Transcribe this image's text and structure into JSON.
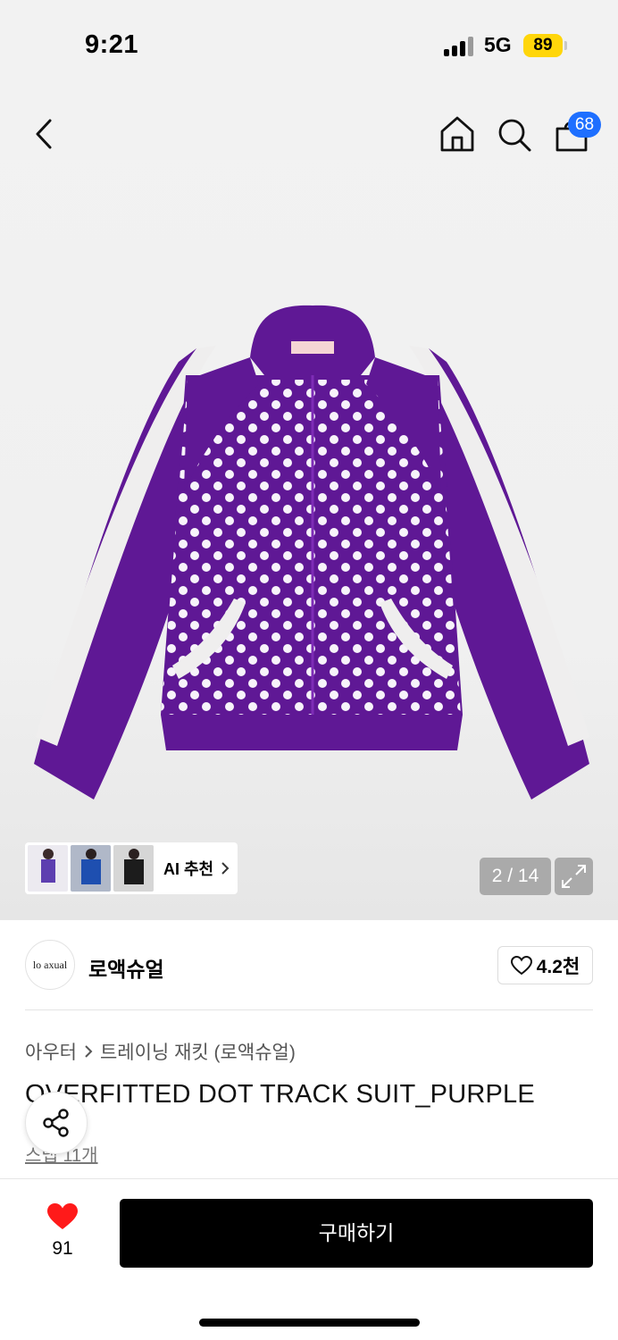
{
  "status_bar": {
    "time": "9:21",
    "network": "5G",
    "battery": "89"
  },
  "header": {
    "back_icon": "chevron-left-icon",
    "home_icon": "home-icon",
    "search_icon": "search-icon",
    "cart_icon": "shopping-bag-icon",
    "cart_count": "68"
  },
  "gallery": {
    "pager": "2 / 14",
    "ai_recommend_label": "AI 추천",
    "expand_icon": "expand-icon"
  },
  "brand": {
    "logo_text": "lo axual",
    "name": "로액슈얼",
    "like_count": "4.2천"
  },
  "product": {
    "breadcrumb": [
      "아우터",
      "트레이닝 재킷 (로액슈얼)"
    ],
    "title": "OVERFITTED DOT TRACK SUIT_PURPLE",
    "snap_link": "스냅 11개"
  },
  "bottom_bar": {
    "like_count": "91",
    "buy_label": "구매하기"
  },
  "colors": {
    "accent_badge": "#1e6fff",
    "battery": "#ffd60a",
    "heart": "#ff1a1a",
    "jacket_purple": "#5f1895"
  }
}
